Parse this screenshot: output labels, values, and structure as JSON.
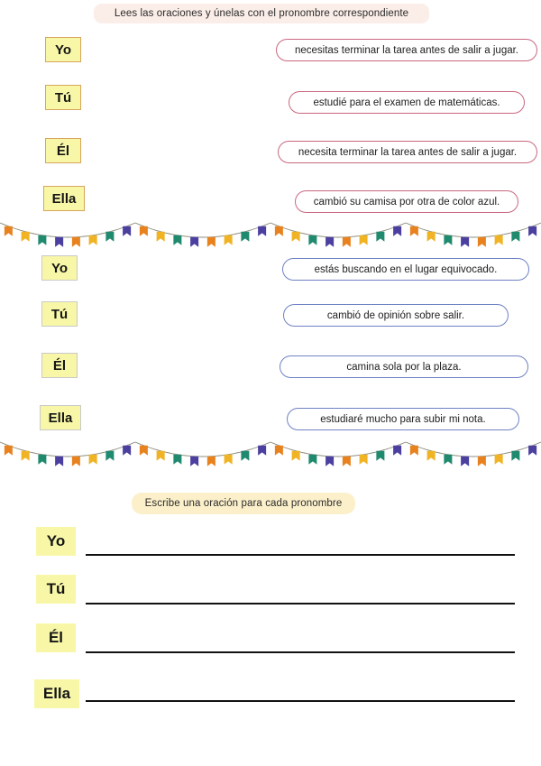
{
  "worksheet": {
    "section1": {
      "header": "Lees las oraciones y únelas con el pronombre correspondiente",
      "pronouns": [
        "Yo",
        "Tú",
        "Él",
        "Ella"
      ],
      "sentences": [
        "necesitas terminar la tarea antes de salir a jugar.",
        "estudié para el examen de matemáticas.",
        "necesita terminar la tarea antes de salir a jugar.",
        "cambió su camisa por otra de color azul."
      ],
      "oval_color": "#c9687f",
      "chip_fill": "#f8f7a8",
      "chip_border": "#d8a55c",
      "header_fill": "#fbeee8"
    },
    "section2": {
      "pronouns": [
        "Yo",
        "Tú",
        "Él",
        "Ella"
      ],
      "sentences": [
        "estás buscando en el lugar equivocado.",
        "cambió de opinión sobre salir.",
        "camina sola por la plaza.",
        "estudiaré mucho para subir mi nota."
      ],
      "oval_color": "#6f82c4",
      "chip_fill": "#f8f7a8",
      "chip_border": "#c9c9c9"
    },
    "section3": {
      "header": "Escribe una oración para cada pronombre",
      "header_fill": "#fcf0cb",
      "pronouns": [
        "Yo",
        "Tú",
        "Él",
        "Ella"
      ],
      "line_color": "#111111"
    },
    "decoration": {
      "bunting_flag_colors": [
        "#e8821e",
        "#f0b323",
        "#1f8a6e",
        "#4b3fa0"
      ],
      "bunting_string_color": "#8a8a7a",
      "bunting_rows": 2,
      "segments_per_row": 4,
      "flags_per_segment": 8
    }
  }
}
